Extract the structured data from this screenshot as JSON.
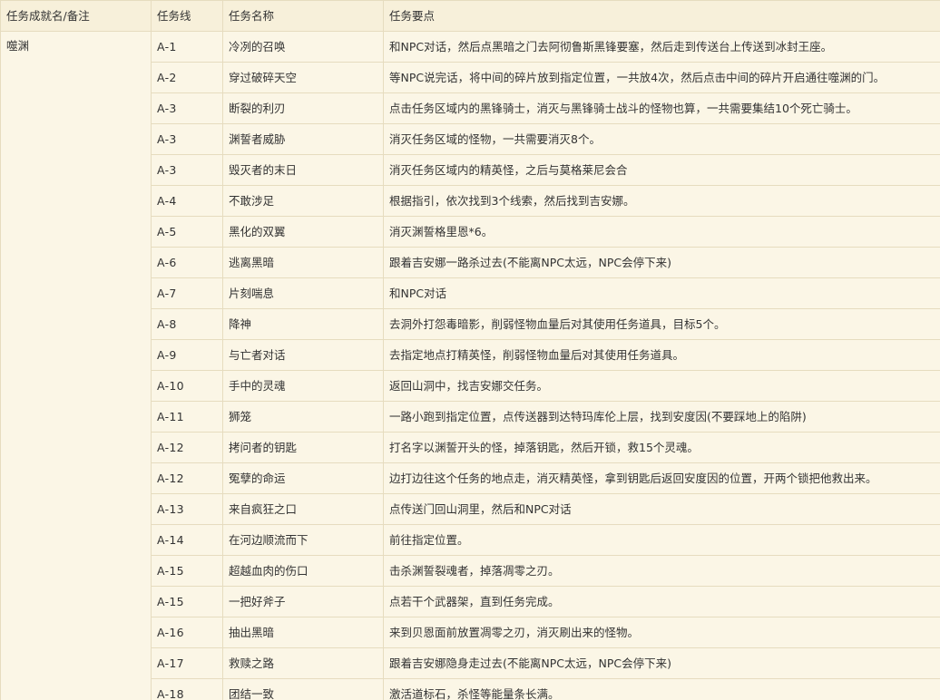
{
  "headers": {
    "achievement": "任务成就名/备注",
    "questline": "任务线",
    "name": "任务名称",
    "notes": "任务要点"
  },
  "achievement_name": "噬渊",
  "rows": [
    {
      "line": "A-1",
      "name": "冷冽的召唤",
      "notes": "和NPC对话，然后点黑暗之门去阿彻鲁斯黑锋要塞，然后走到传送台上传送到冰封王座。"
    },
    {
      "line": "A-2",
      "name": "穿过破碎天空",
      "notes": "等NPC说完话，将中间的碎片放到指定位置，一共放4次，然后点击中间的碎片开启通往噬渊的门。"
    },
    {
      "line": "A-3",
      "name": "断裂的利刃",
      "notes": "点击任务区域内的黑锋骑士，消灭与黑锋骑士战斗的怪物也算，一共需要集结10个死亡骑士。"
    },
    {
      "line": "A-3",
      "name": "渊誓者威胁",
      "notes": "消灭任务区域的怪物，一共需要消灭8个。"
    },
    {
      "line": "A-3",
      "name": "毁灭者的末日",
      "notes": "消灭任务区域内的精英怪，之后与莫格莱尼会合"
    },
    {
      "line": "A-4",
      "name": "不敢涉足",
      "notes": "根据指引，依次找到3个线索，然后找到吉安娜。"
    },
    {
      "line": "A-5",
      "name": "黑化的双翼",
      "notes": "消灭渊誓格里恩*6。"
    },
    {
      "line": "A-6",
      "name": "逃离黑暗",
      "notes": "跟着吉安娜一路杀过去(不能离NPC太远，NPC会停下来)"
    },
    {
      "line": "A-7",
      "name": "片刻喘息",
      "notes": "和NPC对话"
    },
    {
      "line": "A-8",
      "name": "降神",
      "notes": "去洞外打怨毒暗影，削弱怪物血量后对其使用任务道具，目标5个。"
    },
    {
      "line": "A-9",
      "name": "与亡者对话",
      "notes": "去指定地点打精英怪，削弱怪物血量后对其使用任务道具。"
    },
    {
      "line": "A-10",
      "name": "手中的灵魂",
      "notes": "返回山洞中，找吉安娜交任务。"
    },
    {
      "line": "A-11",
      "name": "狮笼",
      "notes": "一路小跑到指定位置，点传送器到达特玛库伦上层，找到安度因(不要踩地上的陷阱)"
    },
    {
      "line": "A-12",
      "name": "拷问者的钥匙",
      "notes": "打名字以渊誓开头的怪，掉落钥匙，然后开锁，救15个灵魂。"
    },
    {
      "line": "A-12",
      "name": "冤孽的命运",
      "notes": "边打边往这个任务的地点走，消灭精英怪，拿到钥匙后返回安度因的位置，开两个锁把他救出来。"
    },
    {
      "line": "A-13",
      "name": "来自疯狂之口",
      "notes": "点传送门回山洞里，然后和NPC对话"
    },
    {
      "line": "A-14",
      "name": "在河边顺流而下",
      "notes": "前往指定位置。"
    },
    {
      "line": "A-15",
      "name": "超越血肉的伤口",
      "notes": "击杀渊誓裂魂者，掉落凋零之刃。"
    },
    {
      "line": "A-15",
      "name": "一把好斧子",
      "notes": "点若干个武器架，直到任务完成。"
    },
    {
      "line": "A-16",
      "name": "抽出黑暗",
      "notes": "来到贝恩面前放置凋零之刃，消灭刷出来的怪物。"
    },
    {
      "line": "A-17",
      "name": "救赎之路",
      "notes": "跟着吉安娜隐身走过去(不能离NPC太远，NPC会停下来)"
    },
    {
      "line": "A-18",
      "name": "团结一致",
      "notes": "激活道标石，杀怪等能量条长满。"
    }
  ]
}
